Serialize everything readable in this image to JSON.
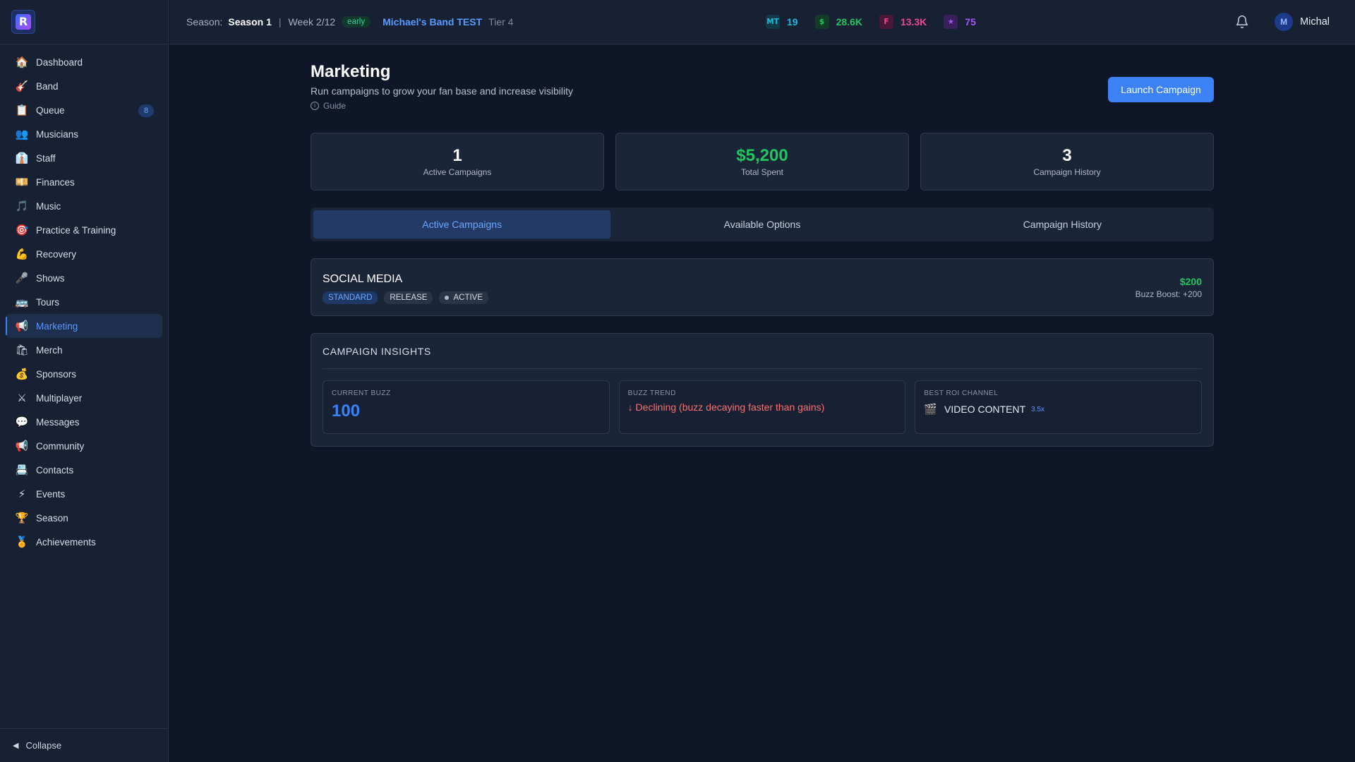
{
  "sidebar": {
    "logo_letter": "R",
    "items": [
      {
        "label": "Dashboard",
        "icon": "🏠"
      },
      {
        "label": "Band",
        "icon": "🎸"
      },
      {
        "label": "Queue",
        "icon": "📋",
        "badge": "8"
      },
      {
        "label": "Musicians",
        "icon": "👥"
      },
      {
        "label": "Staff",
        "icon": "👔"
      },
      {
        "label": "Finances",
        "icon": "💴"
      },
      {
        "label": "Music",
        "icon": "🎵"
      },
      {
        "label": "Practice & Training",
        "icon": "🎯"
      },
      {
        "label": "Recovery",
        "icon": "💪"
      },
      {
        "label": "Shows",
        "icon": "🎤"
      },
      {
        "label": "Tours",
        "icon": "🚌"
      },
      {
        "label": "Marketing",
        "icon": "📢"
      },
      {
        "label": "Merch",
        "icon": "🛍"
      },
      {
        "label": "Sponsors",
        "icon": "💰"
      },
      {
        "label": "Multiplayer",
        "icon": "⚔"
      },
      {
        "label": "Messages",
        "icon": "💬"
      },
      {
        "label": "Community",
        "icon": "📢"
      },
      {
        "label": "Contacts",
        "icon": "📇"
      },
      {
        "label": "Events",
        "icon": "⚡"
      },
      {
        "label": "Season",
        "icon": "🏆"
      },
      {
        "label": "Achievements",
        "icon": "🏅"
      }
    ],
    "collapse_label": "Collapse",
    "collapse_icon": "◀"
  },
  "topbar": {
    "season_label": "Season:",
    "season_value": "Season 1",
    "separator": "|",
    "week": "Week 2/12",
    "phase": "early",
    "band_name": "Michael's Band TEST",
    "tier": "Tier 4",
    "stats": [
      {
        "icon_text": "MT",
        "value": "19",
        "color": "#22b8d8",
        "bg": "#12394a"
      },
      {
        "icon_text": "$",
        "value": "28.6K",
        "color": "#22c55e",
        "bg": "#143a28"
      },
      {
        "icon_text": "F",
        "value": "13.3K",
        "color": "#ec4899",
        "bg": "#4a1836"
      },
      {
        "icon_text": "★",
        "value": "75",
        "color": "#a855f7",
        "bg": "#37215a"
      }
    ],
    "user_initial": "M",
    "user_name": "Michal"
  },
  "main": {
    "title": "Marketing",
    "subtitle": "Run campaigns to grow your fan base and increase visibility",
    "guide_icon": "i",
    "guide_label": "Guide",
    "launch_button": "Launch Campaign",
    "summary": [
      {
        "value": "1",
        "label": "Active Campaigns"
      },
      {
        "value": "$5,200",
        "label": "Total Spent"
      },
      {
        "value": "3",
        "label": "Campaign History"
      }
    ],
    "tabs": [
      "Active Campaigns",
      "Available Options",
      "Campaign History"
    ],
    "active_tab": 0,
    "campaign": {
      "name": "SOCIAL MEDIA",
      "tags": [
        "STANDARD",
        "RELEASE",
        "ACTIVE"
      ],
      "cost": "$200",
      "boost": "Buzz Boost: +200"
    },
    "insights": {
      "title": "CAMPAIGN INSIGHTS",
      "current_buzz_label": "CURRENT BUZZ",
      "current_buzz_value": "100",
      "buzz_trend_label": "BUZZ TREND",
      "buzz_trend_value": "↓ Declining (buzz decaying faster than gains)",
      "best_roi_label": "BEST ROI CHANNEL",
      "best_roi_icon": "🎬",
      "best_roi_value": "VIDEO CONTENT",
      "best_roi_mult": "3.5x"
    }
  },
  "colors": {
    "accent": "#3b82f6",
    "money": "#22c55e",
    "decline": "#f87171"
  }
}
